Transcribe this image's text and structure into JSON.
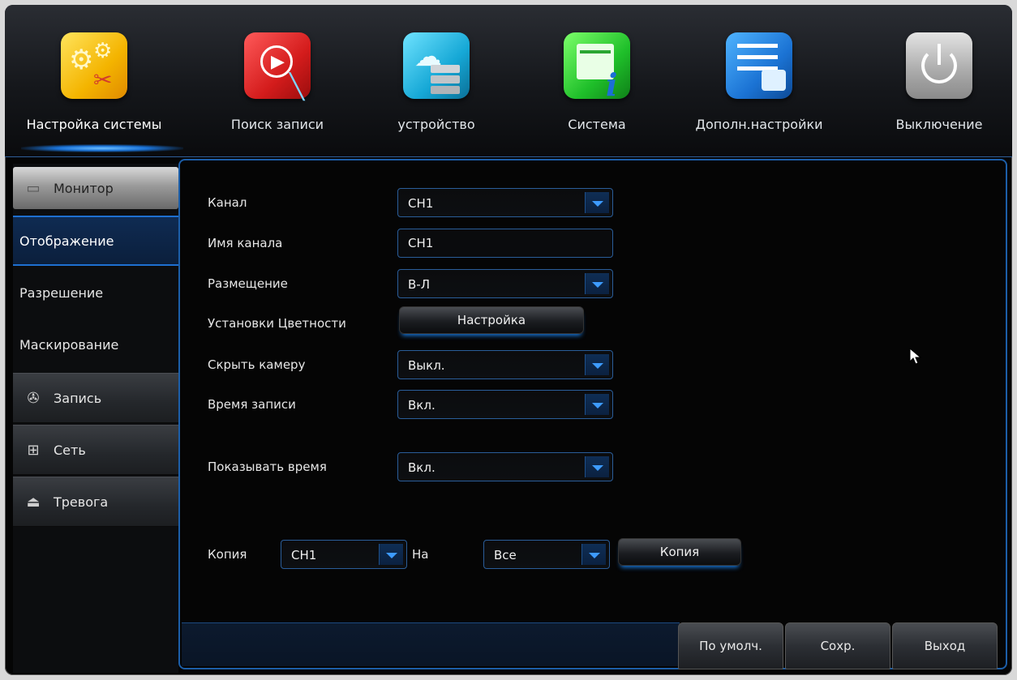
{
  "top_menu": {
    "items": [
      {
        "label": "Настройка системы",
        "icon": "settings-gears-icon"
      },
      {
        "label": "Поиск записи",
        "icon": "video-search-icon"
      },
      {
        "label": "устройство",
        "icon": "storage-device-icon"
      },
      {
        "label": "Система",
        "icon": "system-info-icon"
      },
      {
        "label": "Дополн.настройки",
        "icon": "advanced-settings-icon"
      },
      {
        "label": "Выключение",
        "icon": "power-icon"
      }
    ],
    "active_index": 0
  },
  "sidebar": {
    "monitor_label": "Монитор",
    "sub_items": [
      "Отображение",
      "Разрешение",
      "Маскирование"
    ],
    "selected_sub": "Отображение",
    "sections": [
      {
        "label": "Запись",
        "icon": "film-reel-icon"
      },
      {
        "label": "Сеть",
        "icon": "network-icon"
      },
      {
        "label": "Тревога",
        "icon": "alarm-icon"
      }
    ]
  },
  "form": {
    "channel": {
      "label": "Канал",
      "value": "CH1"
    },
    "channel_name": {
      "label": "Имя канала",
      "value": "CH1"
    },
    "placement": {
      "label": "Размещение",
      "value": "В-Л"
    },
    "color_settings": {
      "label": "Установки Цветности",
      "button": "Настройка"
    },
    "hide_camera": {
      "label": "Скрыть камеру",
      "value": "Выкл."
    },
    "record_time": {
      "label": "Время записи",
      "value": "Вкл."
    },
    "show_time": {
      "label": "Показывать время",
      "value": "Вкл."
    },
    "copy": {
      "label": "Копия",
      "from_value": "CH1",
      "to_label": "На",
      "to_value": "Все",
      "button": "Копия"
    }
  },
  "footer": {
    "default_button": "По умолч.",
    "save_button": "Сохр.",
    "exit_button": "Выход"
  },
  "colors": {
    "accent_blue": "#1e6fd0",
    "border_blue": "#2a5d99",
    "background": "#050505"
  }
}
